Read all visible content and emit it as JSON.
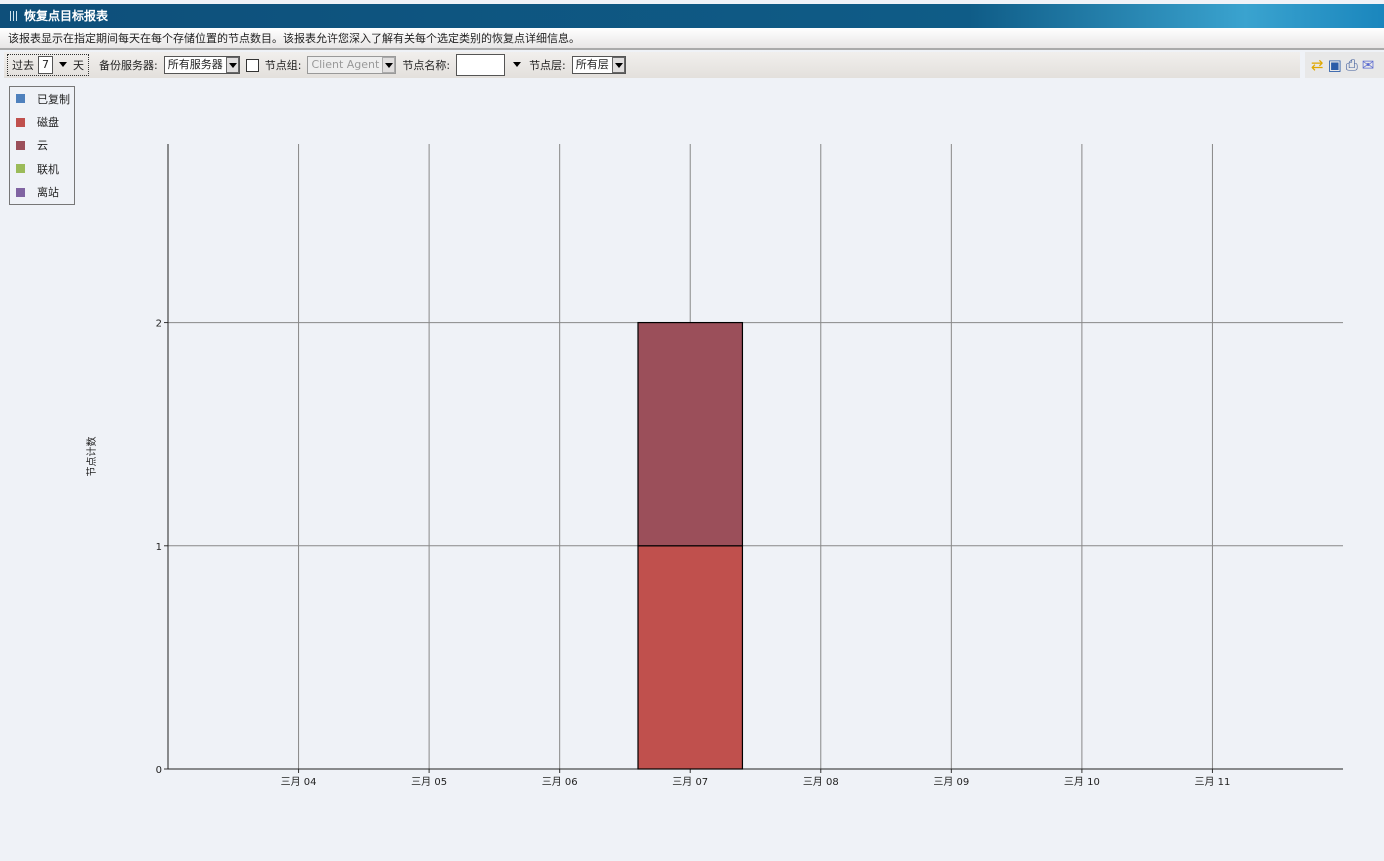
{
  "title": "恢复点目标报表",
  "description": "该报表显示在指定期间每天在每个存储位置的节点数目。该报表允许您深入了解有关每个选定类别的恢复点详细信息。",
  "toolbar": {
    "past_label": "过去",
    "days_value": "7",
    "days_unit": "天",
    "server_label": "备份服务器:",
    "server_value": "所有服务器",
    "node_group_checked": false,
    "node_group_label": "节点组:",
    "node_group_value": "Client Agent",
    "node_name_label": "节点名称:",
    "node_name_value": "",
    "node_tier_label": "节点层:",
    "node_tier_value": "所有层"
  },
  "actions": [
    "refresh-icon",
    "save-icon",
    "print-icon",
    "email-icon"
  ],
  "chart_data": {
    "type": "bar",
    "stacked": true,
    "ylabel": "节点计数",
    "xlabel": "",
    "ylim": [
      0,
      2.8
    ],
    "yticks": [
      0,
      1,
      2
    ],
    "x_domain": [
      "三月 03",
      "三月 12"
    ],
    "categories": [
      "三月 04",
      "三月 05",
      "三月 06",
      "三月 07",
      "三月 08",
      "三月 09",
      "三月 10",
      "三月 11"
    ],
    "grid": true,
    "legend_position": "top-left",
    "series": [
      {
        "name": "已复制",
        "color": "#4f81bd",
        "values": [
          0,
          0,
          0,
          0,
          0,
          0,
          0,
          0
        ]
      },
      {
        "name": "磁盘",
        "color": "#c0504d",
        "values": [
          0,
          0,
          0,
          1,
          0,
          0,
          0,
          0
        ]
      },
      {
        "name": "云",
        "color": "#9b4f5a",
        "values": [
          0,
          0,
          0,
          1,
          0,
          0,
          0,
          0
        ]
      },
      {
        "name": "联机",
        "color": "#9bbb59",
        "values": [
          0,
          0,
          0,
          0,
          0,
          0,
          0,
          0
        ]
      },
      {
        "name": "离站",
        "color": "#8064a2",
        "values": [
          0,
          0,
          0,
          0,
          0,
          0,
          0,
          0
        ]
      }
    ]
  }
}
